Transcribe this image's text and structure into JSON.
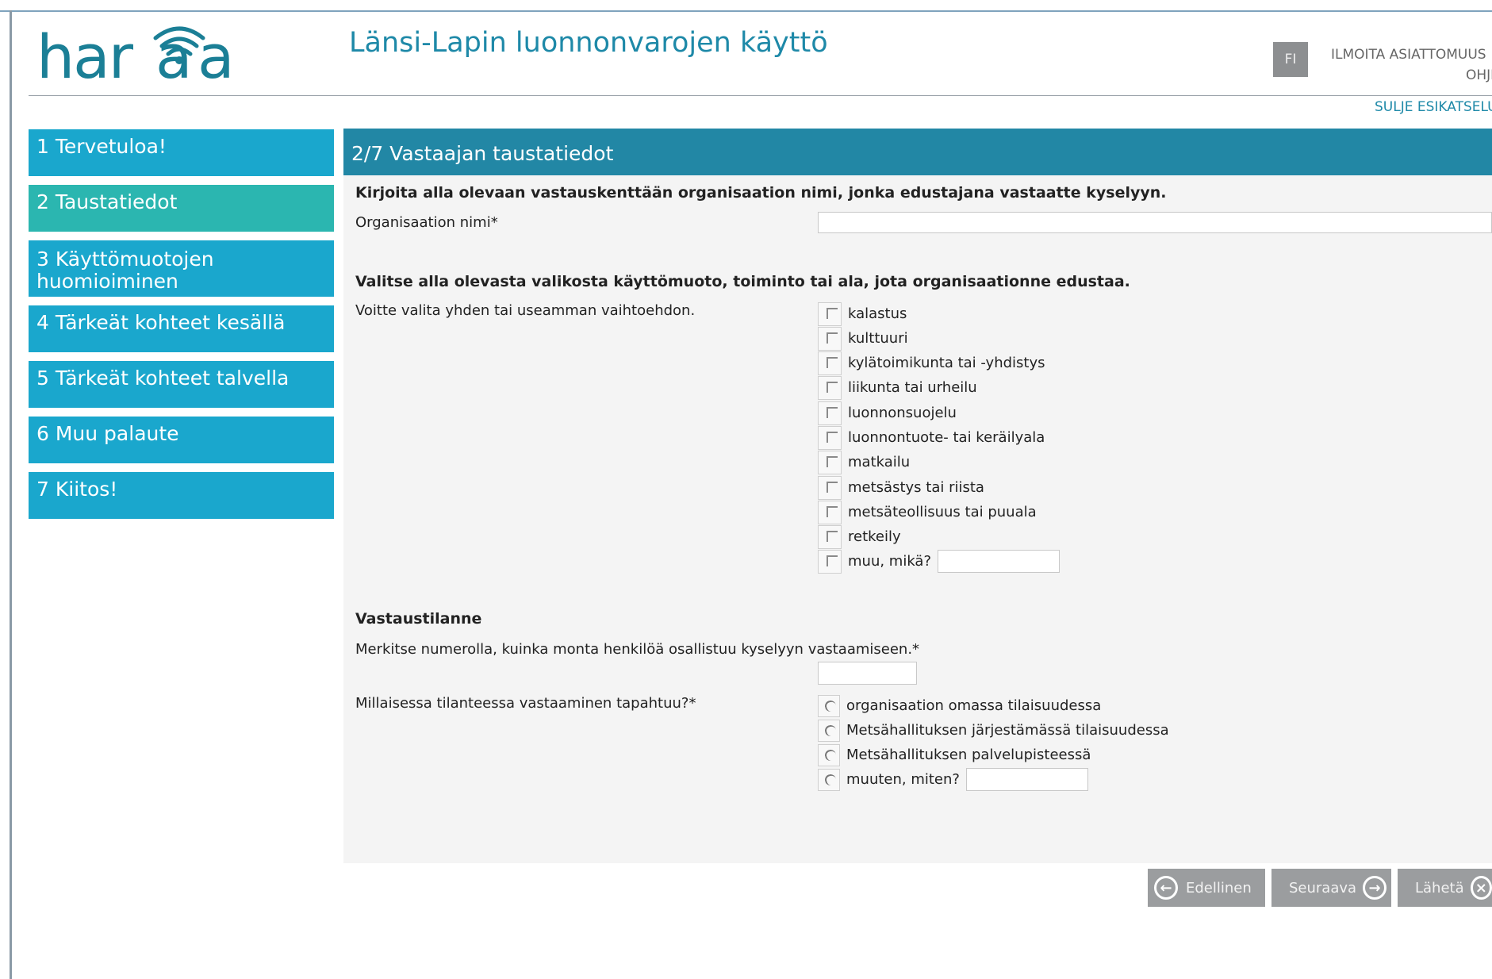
{
  "header": {
    "logo_text": "hara",
    "title": "Länsi-Lapin luonnonvarojen käyttö",
    "language": "FI",
    "report_line1": "ILMOITA ASIATTOMUUS",
    "report_line2": "OHJE",
    "close_preview": "SULJE ESIKATSELU"
  },
  "nav": {
    "items": [
      {
        "label": "1 Tervetuloa!"
      },
      {
        "label": "2 Taustatiedot"
      },
      {
        "label": "3 Käyttömuotojen huomioiminen"
      },
      {
        "label": "4 Tärkeät kohteet kesällä"
      },
      {
        "label": "5 Tärkeät kohteet talvella"
      },
      {
        "label": "6 Muu palaute"
      },
      {
        "label": "7 Kiitos!"
      }
    ]
  },
  "section": {
    "title": "2/7 Vastaajan taustatiedot",
    "q1_instruction": "Kirjoita alla olevaan vastauskenttään organisaation nimi, jonka edustajana vastaatte kyselyyn.",
    "q1_label": "Organisaation nimi*",
    "q1_value": "",
    "q2_instruction": "Valitse alla olevasta valikosta käyttömuoto, toiminto tai ala, jota organisaationne edustaa.",
    "q2_hint": "Voitte valita yhden tai useamman vaihtoehdon.",
    "q2_options": [
      {
        "label": "kalastus"
      },
      {
        "label": "kulttuuri"
      },
      {
        "label": "kylätoimikunta tai -yhdistys"
      },
      {
        "label": "liikunta tai urheilu"
      },
      {
        "label": "luonnonsuojelu"
      },
      {
        "label": "luonnontuote- tai keräilyala"
      },
      {
        "label": "matkailu"
      },
      {
        "label": "metsästys tai riista"
      },
      {
        "label": "metsäteollisuus tai puuala"
      },
      {
        "label": "retkeily"
      },
      {
        "label": "muu, mikä?"
      }
    ],
    "q3_heading": "Vastaustilanne",
    "q3_label": "Merkitse numerolla, kuinka monta henkilöä osallistuu kyselyyn vastaamiseen.*",
    "q4_label": "Millaisessa tilanteessa vastaaminen tapahtuu?*",
    "q4_options": [
      {
        "label": "organisaation omassa tilaisuudessa"
      },
      {
        "label": "Metsähallituksen järjestämässä tilaisuudessa"
      },
      {
        "label": "Metsähallituksen palvelupisteessä"
      },
      {
        "label": "muuten, miten?"
      }
    ]
  },
  "footer": {
    "prev_label": "Edellinen",
    "next_label": "Seuraava",
    "send_label": "Lähetä"
  },
  "colors": {
    "nav_item": "#1aa7cd",
    "nav_active": "#2bb6b0",
    "section_header": "#2287a5",
    "button": "#9b9d9f"
  }
}
